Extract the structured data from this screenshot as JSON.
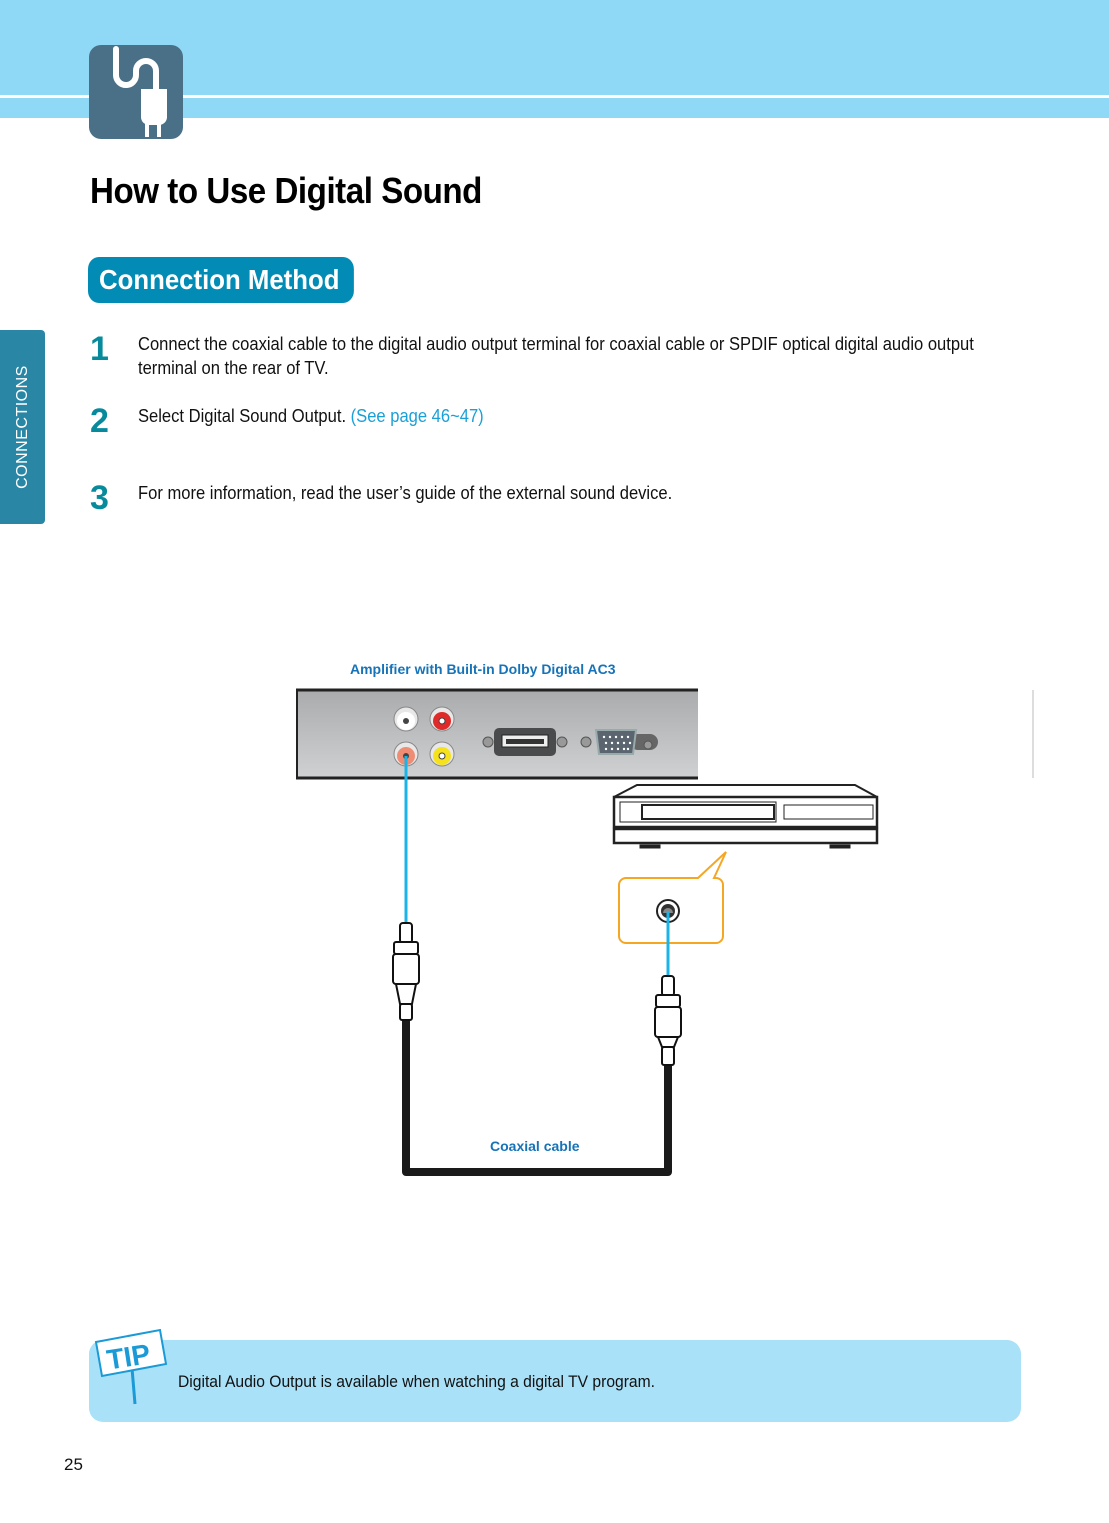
{
  "header": {
    "chapter_icon": "plug-icon",
    "band_color": "#8fd9f6",
    "icon_color": "#4a7088"
  },
  "page_title": "How to Use Digital Sound",
  "section": {
    "title": "Connection Method",
    "color": "#028bb5"
  },
  "side_tab": {
    "label": "CONNECTIONS",
    "color": "#2a86a5"
  },
  "steps": [
    {
      "number": "1",
      "text": "Connect the coaxial cable to the digital audio output terminal for coaxial cable or SPDIF optical digital audio output terminal on the rear of TV.",
      "link": ""
    },
    {
      "number": "2",
      "text": "Select Digital Sound Output. ",
      "link": "(See page 46~47)"
    },
    {
      "number": "3",
      "text": "For more information, read the user’s guide of the external sound device.",
      "link": ""
    }
  ],
  "diagram": {
    "device_label": "Amplifier with Built-in Dolby Digital AC3",
    "cable_label": "Coaxial cable",
    "panel_ports": [
      "white-rca-jack",
      "red-rca-jack",
      "orange-coaxial-jack",
      "yellow-rca-jack",
      "hdmi-port",
      "vga-port"
    ],
    "cable_color": "#1ab4e8",
    "callout_color": "#f5a623"
  },
  "tip": {
    "badge": "TIP",
    "text": "Digital Audio Output is available when watching a digital TV program."
  },
  "page_number": "25"
}
